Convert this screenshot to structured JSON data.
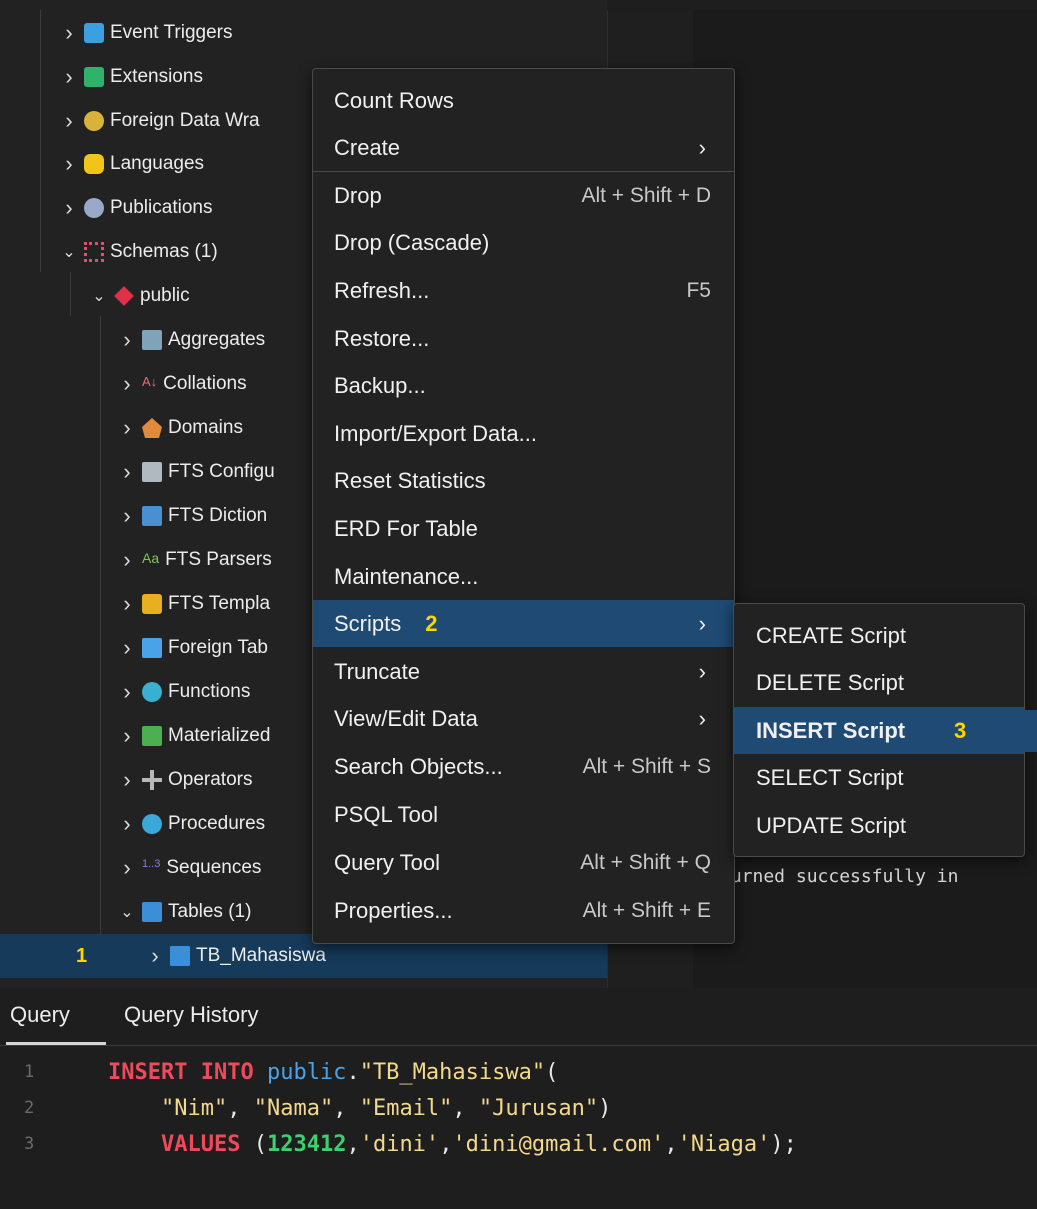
{
  "tree": {
    "items": [
      {
        "label": "Event Triggers",
        "icon": "event-trigger-icon",
        "expanded": false
      },
      {
        "label": "Extensions",
        "icon": "extension-icon",
        "expanded": false
      },
      {
        "label": "Foreign Data Wra",
        "icon": "foreign-data-wrapper-icon",
        "expanded": false
      },
      {
        "label": "Languages",
        "icon": "language-icon",
        "expanded": false
      },
      {
        "label": "Publications",
        "icon": "publication-icon",
        "expanded": false
      },
      {
        "label": "Schemas (1)",
        "icon": "schema-icon",
        "expanded": true
      },
      {
        "label": "public",
        "icon": "schema-public-icon",
        "expanded": true
      },
      {
        "label": "Aggregates",
        "icon": "aggregate-icon",
        "expanded": false
      },
      {
        "label": "Collations",
        "icon": "collation-icon",
        "expanded": false
      },
      {
        "label": "Domains",
        "icon": "domain-icon",
        "expanded": false
      },
      {
        "label": "FTS Configu",
        "icon": "fts-configuration-icon",
        "expanded": false
      },
      {
        "label": "FTS Diction",
        "icon": "fts-dictionary-icon",
        "expanded": false
      },
      {
        "label": "FTS Parsers",
        "icon": "fts-parser-icon",
        "expanded": false
      },
      {
        "label": "FTS Templa",
        "icon": "fts-template-icon",
        "expanded": false
      },
      {
        "label": "Foreign Tab",
        "icon": "foreign-table-icon",
        "expanded": false
      },
      {
        "label": "Functions",
        "icon": "function-icon",
        "expanded": false
      },
      {
        "label": "Materialized",
        "icon": "materialized-view-icon",
        "expanded": false
      },
      {
        "label": "Operators",
        "icon": "operator-icon",
        "expanded": false
      },
      {
        "label": "Procedures",
        "icon": "procedure-icon",
        "expanded": false
      },
      {
        "label": "Sequences",
        "icon": "sequence-icon",
        "expanded": false
      },
      {
        "label": "Tables (1)",
        "icon": "table-group-icon",
        "expanded": true
      },
      {
        "label": "TB_Mahasiswa",
        "icon": "table-icon",
        "expanded": false,
        "step": "1"
      }
    ]
  },
  "messages": {
    "output_fragment": "turned successfully in"
  },
  "context_menu": {
    "items": [
      {
        "label": "Count Rows",
        "shortcut": "",
        "submenu": false
      },
      {
        "label": "Create",
        "shortcut": "",
        "submenu": true
      },
      {
        "label": "Drop",
        "shortcut": "Alt + Shift + D",
        "submenu": false
      },
      {
        "label": "Drop (Cascade)",
        "shortcut": "",
        "submenu": false
      },
      {
        "label": "Refresh...",
        "shortcut": "F5",
        "submenu": false
      },
      {
        "label": "Restore...",
        "shortcut": "",
        "submenu": false
      },
      {
        "label": "Backup...",
        "shortcut": "",
        "submenu": false
      },
      {
        "label": "Import/Export Data...",
        "shortcut": "",
        "submenu": false
      },
      {
        "label": "Reset Statistics",
        "shortcut": "",
        "submenu": false
      },
      {
        "label": "ERD For Table",
        "shortcut": "",
        "submenu": false
      },
      {
        "label": "Maintenance...",
        "shortcut": "",
        "submenu": false
      },
      {
        "label": "Scripts",
        "shortcut": "",
        "submenu": true,
        "step": "2",
        "highlighted": true
      },
      {
        "label": "Truncate",
        "shortcut": "",
        "submenu": true
      },
      {
        "label": "View/Edit Data",
        "shortcut": "",
        "submenu": true
      },
      {
        "label": "Search Objects...",
        "shortcut": "Alt + Shift + S",
        "submenu": false
      },
      {
        "label": "PSQL Tool",
        "shortcut": "",
        "submenu": false
      },
      {
        "label": "Query Tool",
        "shortcut": "Alt + Shift + Q",
        "submenu": false
      },
      {
        "label": "Properties...",
        "shortcut": "Alt + Shift + E",
        "submenu": false
      }
    ],
    "arrow_glyph": "›"
  },
  "scripts_submenu": {
    "items": [
      {
        "label": "CREATE Script"
      },
      {
        "label": "DELETE Script"
      },
      {
        "label": "INSERT Script",
        "step": "3",
        "highlighted": true
      },
      {
        "label": "SELECT Script"
      },
      {
        "label": "UPDATE Script"
      }
    ]
  },
  "query_panel": {
    "tabs": [
      {
        "label": "Query",
        "active": true
      },
      {
        "label": "Query History",
        "active": false
      }
    ],
    "lines": [
      {
        "num": "1",
        "text": "INSERT INTO public.\"TB_Mahasiswa\"("
      },
      {
        "num": "2",
        "text": "    \"Nim\", \"Nama\", \"Email\", \"Jurusan\")"
      },
      {
        "num": "3",
        "text": "    VALUES (123412,'dini','dini@gmail.com','Niaga');"
      }
    ]
  },
  "colors": {
    "highlight": "#1e4a73",
    "step_marker": "#ffd400",
    "keyword": "#ee4a5c",
    "string": "#f3d98b",
    "number": "#3fcf6e",
    "schema": "#4aa3e8"
  }
}
